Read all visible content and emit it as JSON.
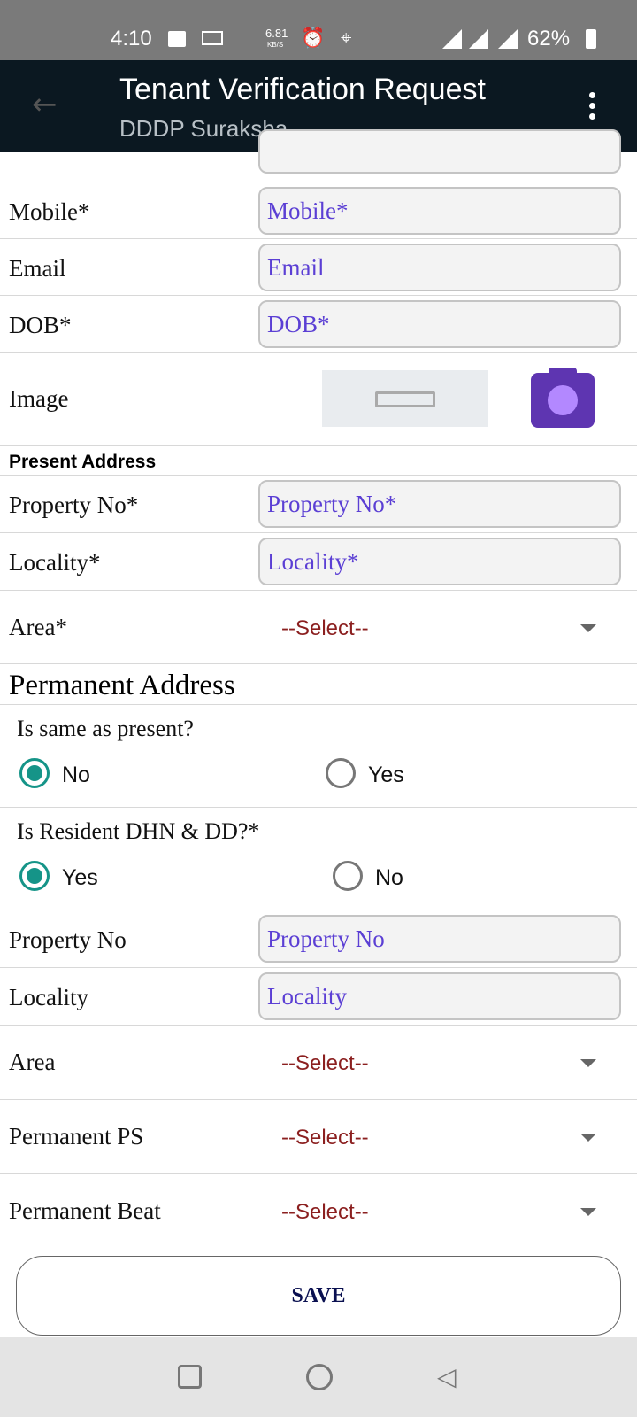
{
  "status": {
    "time": "4:10",
    "speed": "6.81",
    "speed_unit": "KB/S",
    "battery": "62%"
  },
  "appbar": {
    "title": "Tenant Verification Request",
    "subtitle": "DDDP Suraksha"
  },
  "fields": {
    "mobile": {
      "label": "Mobile*",
      "placeholder": "Mobile*"
    },
    "email": {
      "label": "Email",
      "placeholder": "Email"
    },
    "dob": {
      "label": "DOB*",
      "placeholder": "DOB*"
    },
    "image": {
      "label": "Image"
    }
  },
  "present": {
    "heading": "Present Address",
    "property": {
      "label": "Property No*",
      "placeholder": "Property No*"
    },
    "locality": {
      "label": "Locality*",
      "placeholder": "Locality*"
    },
    "area": {
      "label": "Area*",
      "value": "--Select--"
    }
  },
  "permanent": {
    "heading": "Permanent Address",
    "same": {
      "question": "Is same as present?",
      "options": [
        "No",
        "Yes"
      ],
      "selected": "No"
    },
    "resident": {
      "question": "Is Resident DHN & DD?*",
      "options": [
        "Yes",
        "No"
      ],
      "selected": "Yes"
    },
    "property": {
      "label": "Property No",
      "placeholder": "Property No"
    },
    "locality": {
      "label": "Locality",
      "placeholder": "Locality"
    },
    "area": {
      "label": "Area",
      "value": "--Select--"
    },
    "ps": {
      "label": "Permanent PS",
      "value": "--Select--"
    },
    "beat": {
      "label": "Permanent Beat",
      "value": "--Select--"
    }
  },
  "save_label": "SAVE",
  "colors": {
    "appbar": "#0b1821",
    "accent": "#5b3fd4",
    "radio": "#159488",
    "select": "#8b1f1f"
  }
}
